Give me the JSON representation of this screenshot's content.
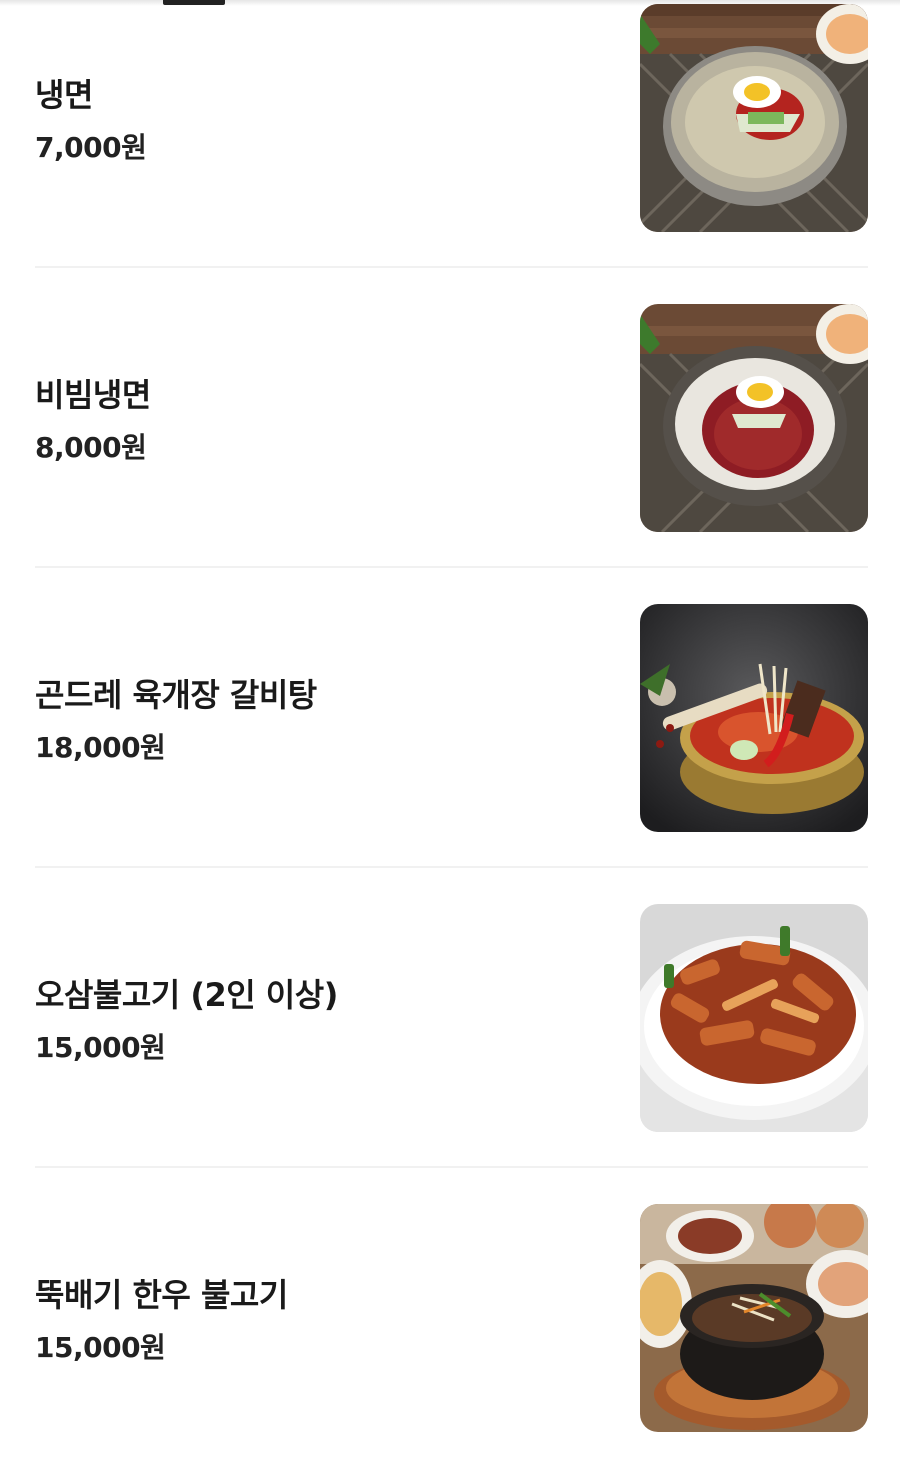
{
  "menu": {
    "items": [
      {
        "name": "냉면",
        "price": "7,000원",
        "image": "naengmyeon-photo"
      },
      {
        "name": "비빔냉면",
        "price": "8,000원",
        "image": "bibim-naengmyeon-photo"
      },
      {
        "name": "곤드레 육개장 갈비탕",
        "price": "18,000원",
        "image": "galbitang-photo"
      },
      {
        "name": "오삼불고기 (2인 이상)",
        "price": "15,000원",
        "image": "osam-bulgogi-photo"
      },
      {
        "name": "뚝배기 한우 불고기",
        "price": "15,000원",
        "image": "ttukbaegi-bulgogi-photo"
      }
    ]
  }
}
